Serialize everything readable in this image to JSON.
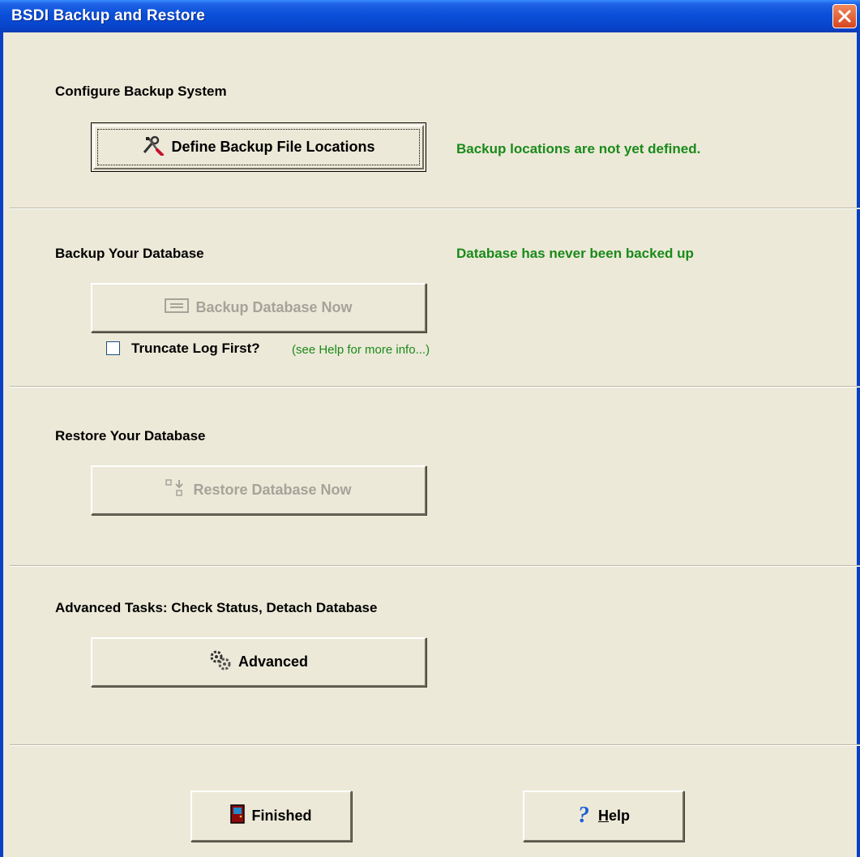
{
  "window": {
    "title": "BSDI Backup and Restore"
  },
  "configure": {
    "heading": "Configure Backup System",
    "button_label": "Define Backup File Locations",
    "status": "Backup locations are not yet defined."
  },
  "backup": {
    "heading": "Backup Your Database",
    "status": "Database has never been backed up",
    "button_label": "Backup Database Now",
    "checkbox_label": "Truncate Log First?",
    "checkbox_checked": false,
    "hint": "(see Help for more info...)"
  },
  "restore": {
    "heading": "Restore Your Database",
    "button_label": "Restore Database Now"
  },
  "advanced": {
    "heading": "Advanced Tasks: Check Status, Detach Database",
    "button_label": "Advanced"
  },
  "footer": {
    "finished_label": "Finished",
    "help_label_prefix": "H",
    "help_label_rest": "elp"
  },
  "colors": {
    "status_green": "#1a8a1a",
    "titlebar_blue": "#0a4fd8",
    "window_bg": "#ece9d8"
  }
}
